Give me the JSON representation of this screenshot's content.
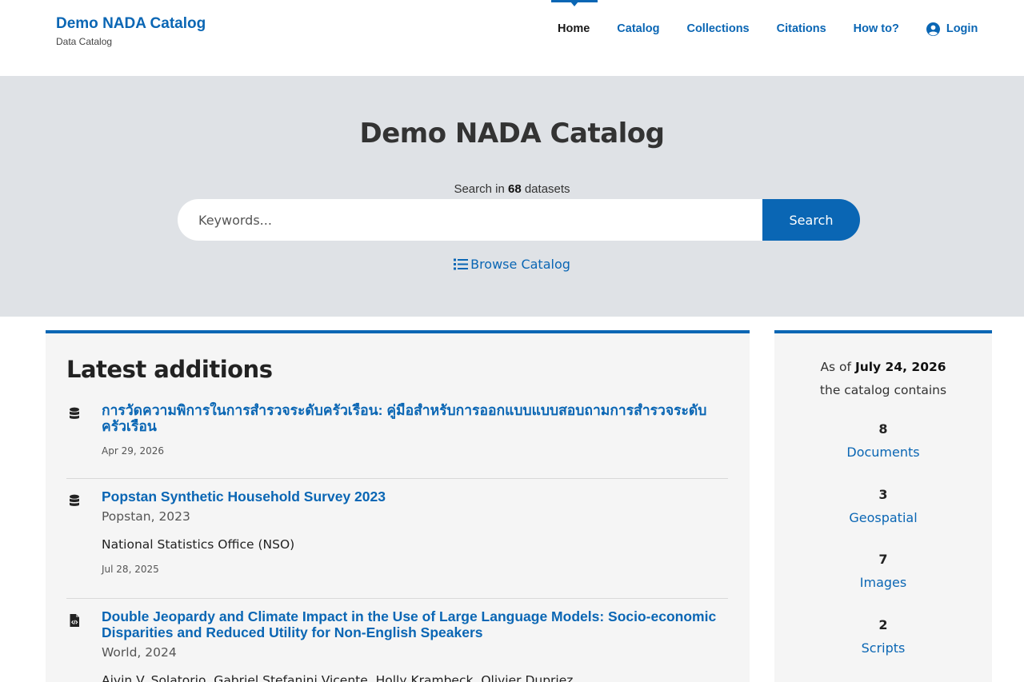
{
  "brand": {
    "title": "Demo NADA Catalog",
    "subtitle": "Data Catalog"
  },
  "nav": {
    "items": [
      {
        "label": "Home",
        "active": true
      },
      {
        "label": "Catalog"
      },
      {
        "label": "Collections"
      },
      {
        "label": "Citations"
      },
      {
        "label": "How to?"
      },
      {
        "label": "Login",
        "icon": "user-circle-icon"
      }
    ]
  },
  "hero": {
    "title": "Demo NADA Catalog",
    "count_prefix": "Search in",
    "count": "68",
    "count_suffix": "datasets",
    "search_placeholder": "Keywords...",
    "search_button": "Search",
    "browse_label": "Browse Catalog"
  },
  "latest": {
    "heading": "Latest additions",
    "items": [
      {
        "icon": "database-icon",
        "title": "การวัดความพิการในการสำรวจระดับครัวเรือน: คู่มือสำหรับการออกแบบแบบสอบถามการสำรวจระดับครัวเรือน",
        "date": "Apr 29, 2026"
      },
      {
        "icon": "database-icon",
        "title": "Popstan Synthetic Household Survey 2023",
        "subtitle": "Popstan, 2023",
        "org": "National Statistics Office (NSO)",
        "date": "Jul 28, 2025"
      },
      {
        "icon": "code-file-icon",
        "title": "Double Jeopardy and Climate Impact in the Use of Large Language Models: Socio-economic Disparities and Reduced Utility for Non-English Speakers",
        "subtitle": "World, 2024",
        "org": "Aivin V. Solatorio, Gabriel Stefanini Vicente, Holly Krambeck, Olivier Dupriez"
      }
    ]
  },
  "stats": {
    "asof_prefix": "As of",
    "asof_date": "July 24, 2026",
    "contains": "the catalog contains",
    "counts": [
      {
        "num": "8",
        "label": "Documents"
      },
      {
        "num": "3",
        "label": "Geospatial"
      },
      {
        "num": "7",
        "label": "Images"
      },
      {
        "num": "2",
        "label": "Scripts"
      }
    ]
  },
  "colors": {
    "accent": "#0a66b4",
    "hero_bg": "#dfe2e6",
    "panel_bg": "#f5f5f5"
  }
}
